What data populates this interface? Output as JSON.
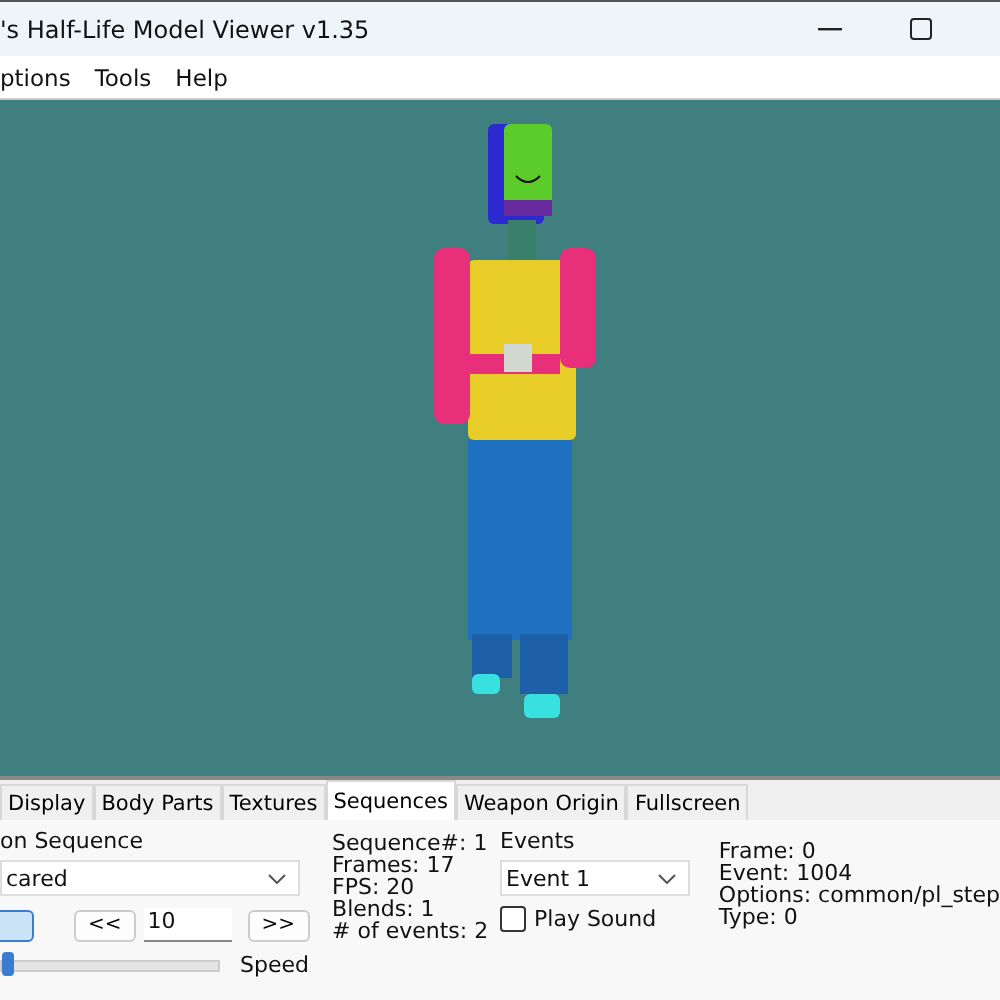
{
  "window": {
    "title": "'s Half-Life Model Viewer v1.35"
  },
  "menu": [
    "ptions",
    "Tools",
    "Help"
  ],
  "tabs": [
    {
      "label": "Display",
      "selected": false
    },
    {
      "label": "Body Parts",
      "selected": false
    },
    {
      "label": "Textures",
      "selected": false
    },
    {
      "label": "Sequences",
      "selected": true
    },
    {
      "label": "Weapon Origin",
      "selected": false
    },
    {
      "label": "Fullscreen",
      "selected": false
    }
  ],
  "sequence": {
    "label": "on Sequence",
    "value": "cared",
    "frame_value": "10",
    "prev": "<<",
    "next": ">>",
    "speed_label": "Speed",
    "speed": {
      "level": 0.0
    }
  },
  "info": [
    "Sequence#: 1",
    "Frames: 17",
    "FPS: 20",
    "Blends: 1",
    "# of events: 2"
  ],
  "events": {
    "label": "Events",
    "value": "Event 1",
    "play_sound": {
      "label": "Play Sound",
      "checked": false
    }
  },
  "event_info": [
    "Frame: 0",
    "Event: 1004",
    "Options: common/pl_step",
    "Type: 0"
  ]
}
